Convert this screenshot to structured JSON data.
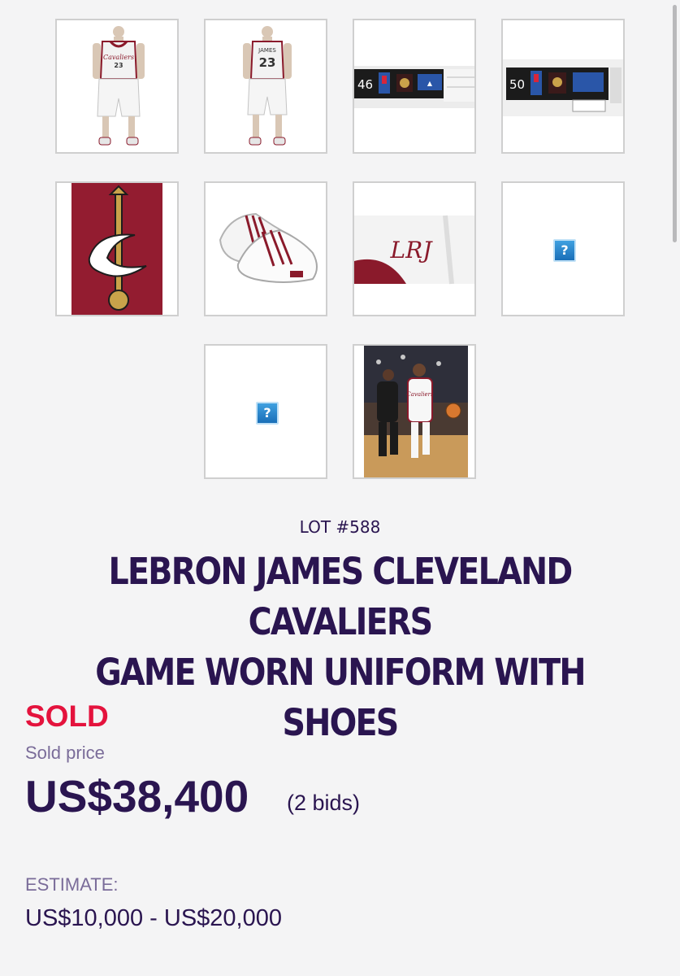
{
  "gallery": {
    "items": [
      {
        "id": "photo-uniform-front",
        "icon": "jersey-front-photo",
        "broken": false
      },
      {
        "id": "photo-uniform-back",
        "icon": "jersey-back-photo",
        "broken": false
      },
      {
        "id": "photo-tag-46",
        "icon": "tag-photo",
        "tag_number": "46",
        "broken": false
      },
      {
        "id": "photo-tag-50",
        "icon": "tag-photo",
        "tag_number": "50",
        "broken": false
      },
      {
        "id": "photo-logo-closeup",
        "icon": "logo-closeup-photo",
        "broken": false
      },
      {
        "id": "photo-shoes",
        "icon": "shoes-photo",
        "broken": false
      },
      {
        "id": "photo-initials",
        "icon": "initials-photo",
        "initials": "LRJ",
        "broken": false
      },
      {
        "id": "photo-missing-1",
        "icon": "broken-image-icon",
        "broken": true
      },
      {
        "id": "photo-missing-2",
        "icon": "broken-image-icon",
        "broken": true
      },
      {
        "id": "photo-game-action",
        "icon": "game-action-photo",
        "broken": false
      }
    ]
  },
  "lot": {
    "label": "LOT #588",
    "title_line1": "LEBRON JAMES CLEVELAND CAVALIERS",
    "title_line2": "GAME WORN UNIFORM WITH SHOES"
  },
  "result": {
    "status": "SOLD",
    "sold_price_label": "Sold price",
    "price": "US$38,400",
    "bids": "(2 bids)"
  },
  "estimate": {
    "label": "ESTIMATE:",
    "value": "US$10,000 - US$20,000"
  },
  "colors": {
    "background": "#f4f4f5",
    "title": "#2a1550",
    "sold": "#e4133d",
    "muted": "#7a6c99",
    "wine": "#8a1a2b",
    "gold": "#c9a24a"
  }
}
